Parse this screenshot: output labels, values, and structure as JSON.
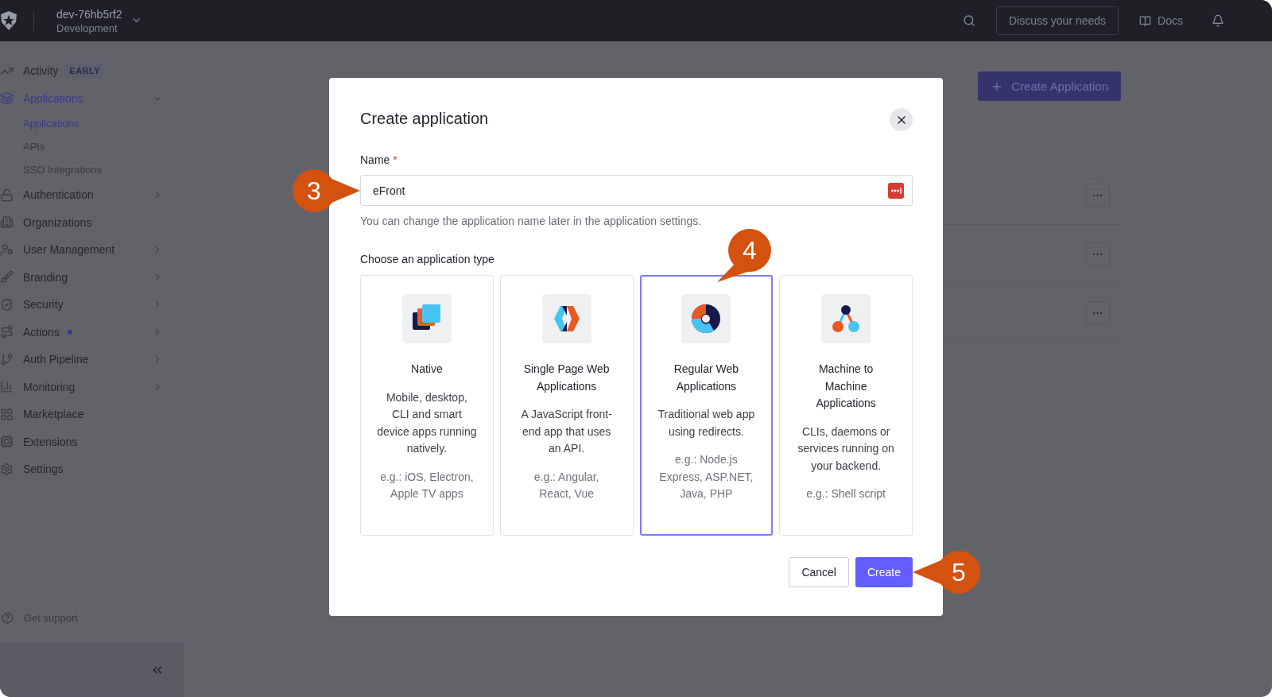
{
  "topbar": {
    "tenant": "dev-76hb5rf2",
    "environment": "Development",
    "discuss_button": "Discuss your needs",
    "docs_link": "Docs"
  },
  "sidebar": {
    "items": [
      {
        "label": "Activity",
        "badge": "EARLY",
        "selected": false,
        "expandable": false
      },
      {
        "label": "Applications",
        "selected": true,
        "expandable": true,
        "expanded": true,
        "children": [
          {
            "label": "Applications",
            "selected": true
          },
          {
            "label": "APIs",
            "selected": false
          },
          {
            "label": "SSO Integrations",
            "selected": false
          }
        ]
      },
      {
        "label": "Authentication",
        "selected": false,
        "expandable": true,
        "expanded": false
      },
      {
        "label": "Organizations",
        "selected": false,
        "expandable": false
      },
      {
        "label": "User Management",
        "selected": false,
        "expandable": true,
        "expanded": false
      },
      {
        "label": "Branding",
        "selected": false,
        "expandable": true,
        "expanded": false
      },
      {
        "label": "Security",
        "selected": false,
        "expandable": true,
        "expanded": false
      },
      {
        "label": "Actions",
        "selected": false,
        "expandable": true,
        "expanded": false,
        "dot": true
      },
      {
        "label": "Auth Pipeline",
        "selected": false,
        "expandable": true,
        "expanded": false
      },
      {
        "label": "Monitoring",
        "selected": false,
        "expandable": true,
        "expanded": false
      },
      {
        "label": "Marketplace",
        "selected": false,
        "expandable": false
      },
      {
        "label": "Extensions",
        "selected": false,
        "expandable": false
      },
      {
        "label": "Settings",
        "selected": false,
        "expandable": false
      }
    ],
    "support_link": "Get support"
  },
  "main": {
    "create_button": "Create Application",
    "rows": [
      {
        "menu_button": "···"
      },
      {
        "menu_button": "···"
      },
      {
        "menu_button": "···"
      }
    ]
  },
  "dialog": {
    "title": "Create application",
    "name_label": "Name",
    "required_mark": "*",
    "name_value": "eFront",
    "name_hint": "You can change the application name later in the application settings.",
    "type_label": "Choose an application type",
    "types": [
      {
        "title": "Native",
        "description": "Mobile, desktop, CLI and smart device apps running natively.",
        "examples": "e.g.: iOS, Electron, Apple TV apps",
        "selected": false
      },
      {
        "title": "Single Page Web Applications",
        "description": "A JavaScript front-end app that uses an API.",
        "examples": "e.g.: Angular, React, Vue",
        "selected": false
      },
      {
        "title": "Regular Web Applications",
        "description": "Traditional web app using redirects.",
        "examples": "e.g.: Node.js Express, ASP.NET, Java, PHP",
        "selected": true
      },
      {
        "title": "Machine to Machine Applications",
        "description": "CLIs, daemons or services running on your backend.",
        "examples": "e.g.: Shell script",
        "selected": false
      }
    ],
    "cancel_button": "Cancel",
    "create_button": "Create"
  },
  "callouts": [
    {
      "number": "3"
    },
    {
      "number": "4"
    },
    {
      "number": "5"
    }
  ]
}
